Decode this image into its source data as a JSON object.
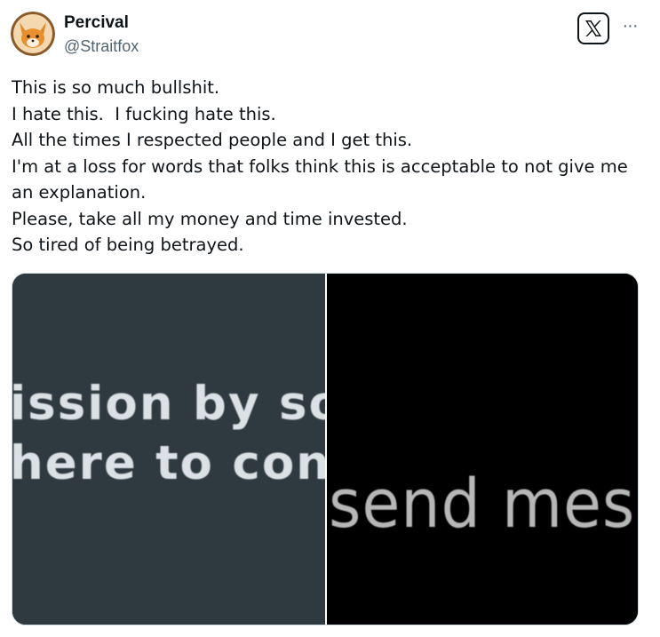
{
  "author": {
    "display_name": "Percival",
    "handle": "@Straitfox",
    "avatar_icon": "fox-avatar-icon"
  },
  "header": {
    "platform_logo": "x-logo-icon",
    "more_label": "···"
  },
  "post": {
    "lines": [
      "This is so much bullshit.",
      "I hate this.  I fucking hate this.",
      "All the times I respected people and I get this.",
      "I'm at a loss for words that folks think this is acceptable to not give me",
      "an explanation.",
      "Please, take all my money and time invested.",
      "So tired of being betrayed."
    ]
  },
  "media": {
    "left_image": {
      "line_1": "ission by so",
      "line_2": "here to cont",
      "background": "#2f3a40"
    },
    "right_image": {
      "text": "send mes",
      "background": "#000000"
    }
  },
  "colors": {
    "text_primary": "#0f1419",
    "text_secondary": "#536471",
    "border": "#cfd9de"
  }
}
